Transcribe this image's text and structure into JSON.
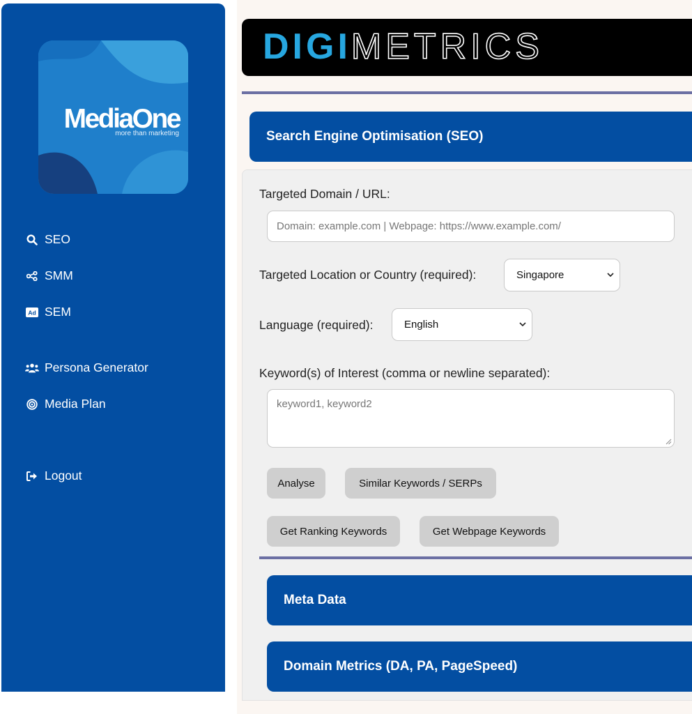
{
  "brand": {
    "logo_name": "MediaOne",
    "logo_tagline": "more than marketing",
    "app_title_accent": "DIGI",
    "app_title_rest": "METRICS"
  },
  "sidebar": {
    "items": [
      {
        "label": "SEO",
        "icon": "search-icon"
      },
      {
        "label": "SMM",
        "icon": "share-icon"
      },
      {
        "label": "SEM",
        "icon": "ad-icon"
      },
      {
        "label": "Persona Generator",
        "icon": "users-icon"
      },
      {
        "label": "Media Plan",
        "icon": "target-icon"
      },
      {
        "label": "Logout",
        "icon": "logout-icon"
      }
    ]
  },
  "seo": {
    "section_title": "Search Engine Optimisation (SEO)",
    "domain_label": "Targeted Domain / URL:",
    "domain_placeholder": "Domain: example.com | Webpage: https://www.example.com/",
    "domain_value": "",
    "location_label": "Targeted Location or Country (required):",
    "location_value": "Singapore",
    "language_label": "Language (required):",
    "language_value": "English",
    "keywords_label": "Keyword(s) of Interest (comma or newline separated):",
    "keywords_placeholder": "keyword1, keyword2",
    "buttons": {
      "analyse": "Analyse",
      "similar": "Similar Keywords / SERPs",
      "ranking": "Get Ranking Keywords",
      "webpage": "Get Webpage Keywords"
    }
  },
  "sections": {
    "meta_data": "Meta Data",
    "domain_metrics": "Domain Metrics (DA, PA, PageSpeed)"
  },
  "colors": {
    "primary": "#034ea2",
    "accent": "#27a7e0",
    "divider": "#6b6fa3",
    "button": "#cfcfcf"
  }
}
